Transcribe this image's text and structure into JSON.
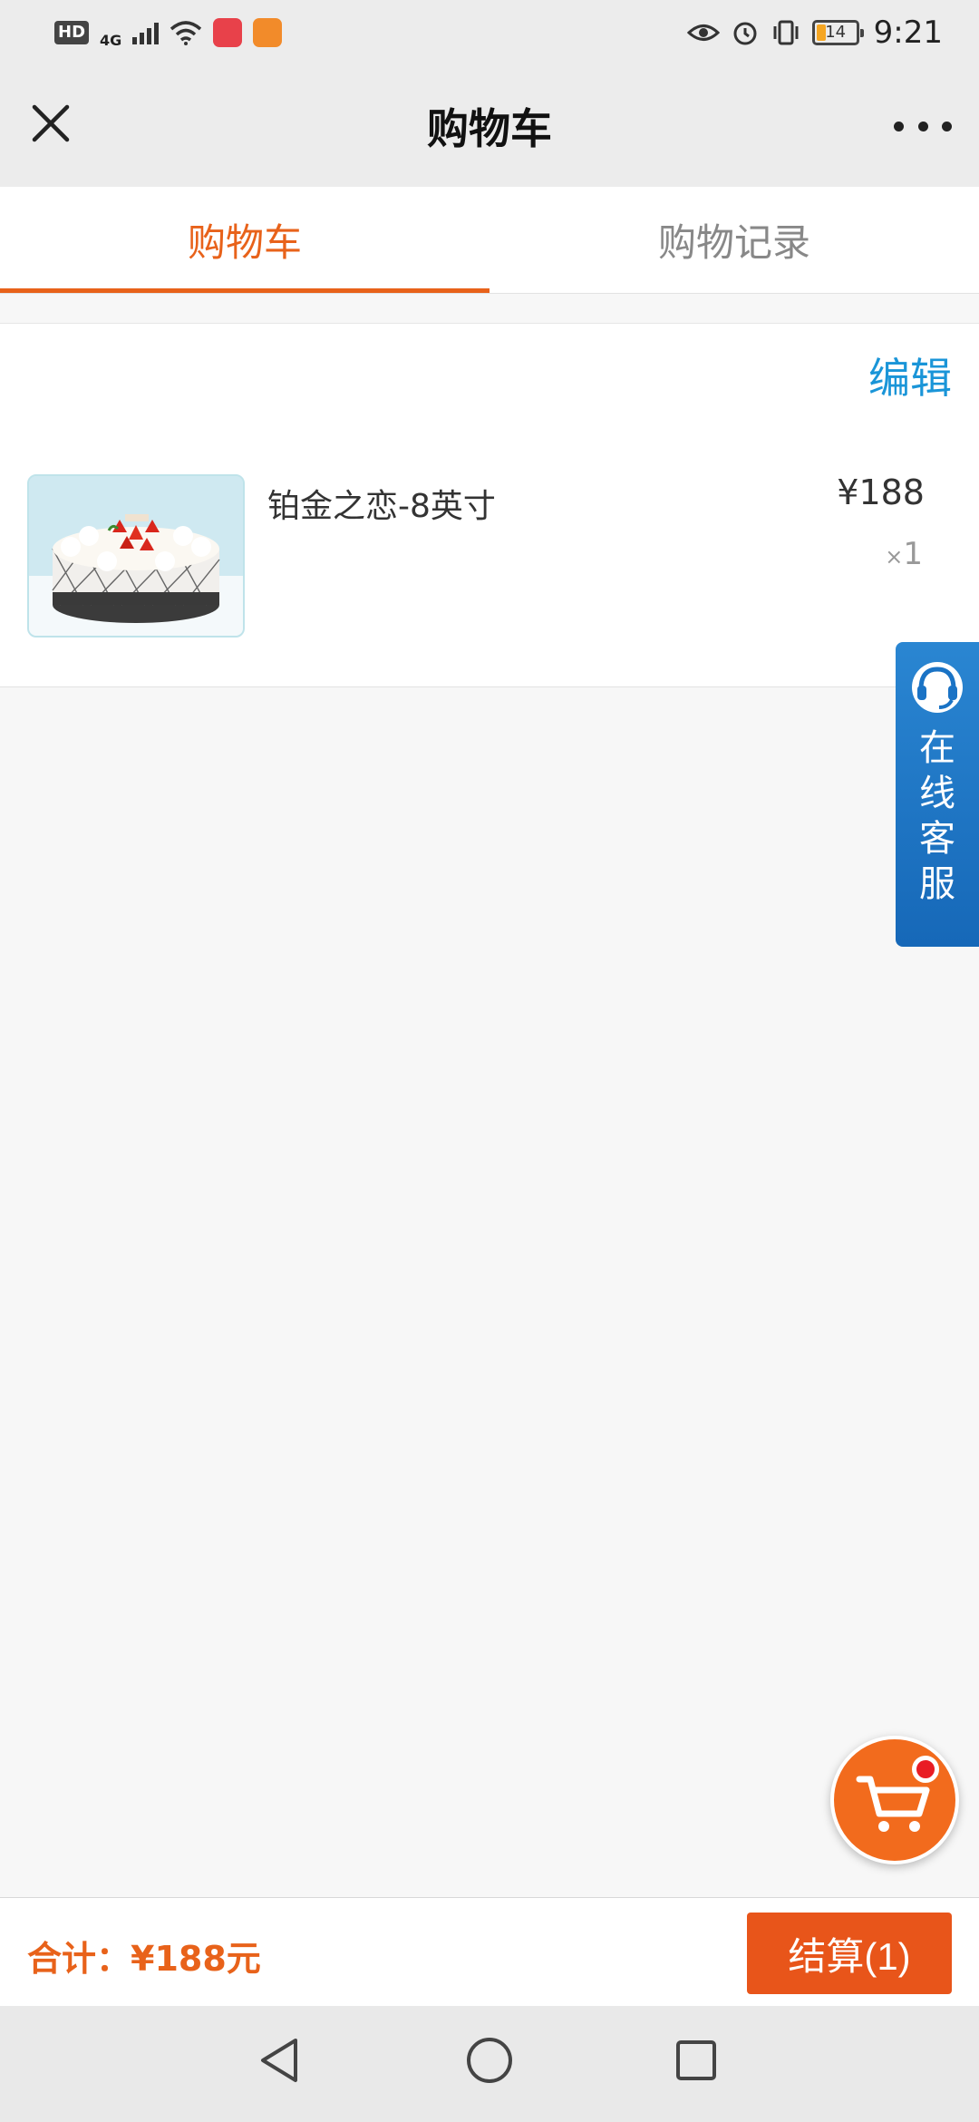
{
  "status_bar": {
    "hd": "HD",
    "network": "4G",
    "battery": "14",
    "time": "9:21"
  },
  "header": {
    "title": "购物车"
  },
  "tabs": [
    {
      "label": "购物车",
      "active": true
    },
    {
      "label": "购物记录",
      "active": false
    }
  ],
  "cart": {
    "edit_label": "编辑",
    "items": [
      {
        "name": "铂金之恋-8英寸",
        "price": "¥188",
        "qty_prefix": "×",
        "qty": "1"
      }
    ]
  },
  "service": {
    "label": "在线客服"
  },
  "footer": {
    "total": "合计：¥188元",
    "checkout_label": "结算(1)"
  },
  "colors": {
    "accent": "#e8621a",
    "link": "#1a95d8",
    "service_bg": "#1a73c5",
    "checkout_bg": "#e8551a"
  },
  "icons": {
    "close": "close-icon",
    "more": "more-icon",
    "cart": "cart-icon",
    "service": "headset-icon",
    "back": "back-triangle-icon",
    "home": "home-circle-icon",
    "recents": "recents-square-icon"
  }
}
